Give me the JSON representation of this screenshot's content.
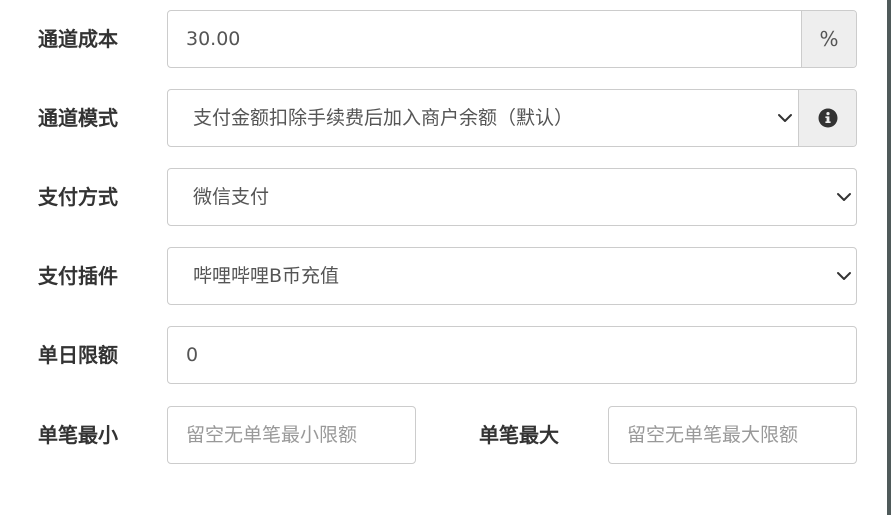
{
  "form": {
    "channel_cost": {
      "label": "通道成本",
      "value": "30.00",
      "addon": "%"
    },
    "channel_mode": {
      "label": "通道模式",
      "selected": "支付金额扣除手续费后加入商户余额（默认）",
      "addon_icon": "info-icon"
    },
    "payment_method": {
      "label": "支付方式",
      "selected": "微信支付"
    },
    "payment_plugin": {
      "label": "支付插件",
      "selected": "哔哩哔哩B币充值"
    },
    "daily_limit": {
      "label": "单日限额",
      "value": "0"
    },
    "single_min": {
      "label": "单笔最小",
      "placeholder": "留空无单笔最小限额"
    },
    "single_max": {
      "label": "单笔最大",
      "placeholder": "留空无单笔最大限额"
    }
  }
}
